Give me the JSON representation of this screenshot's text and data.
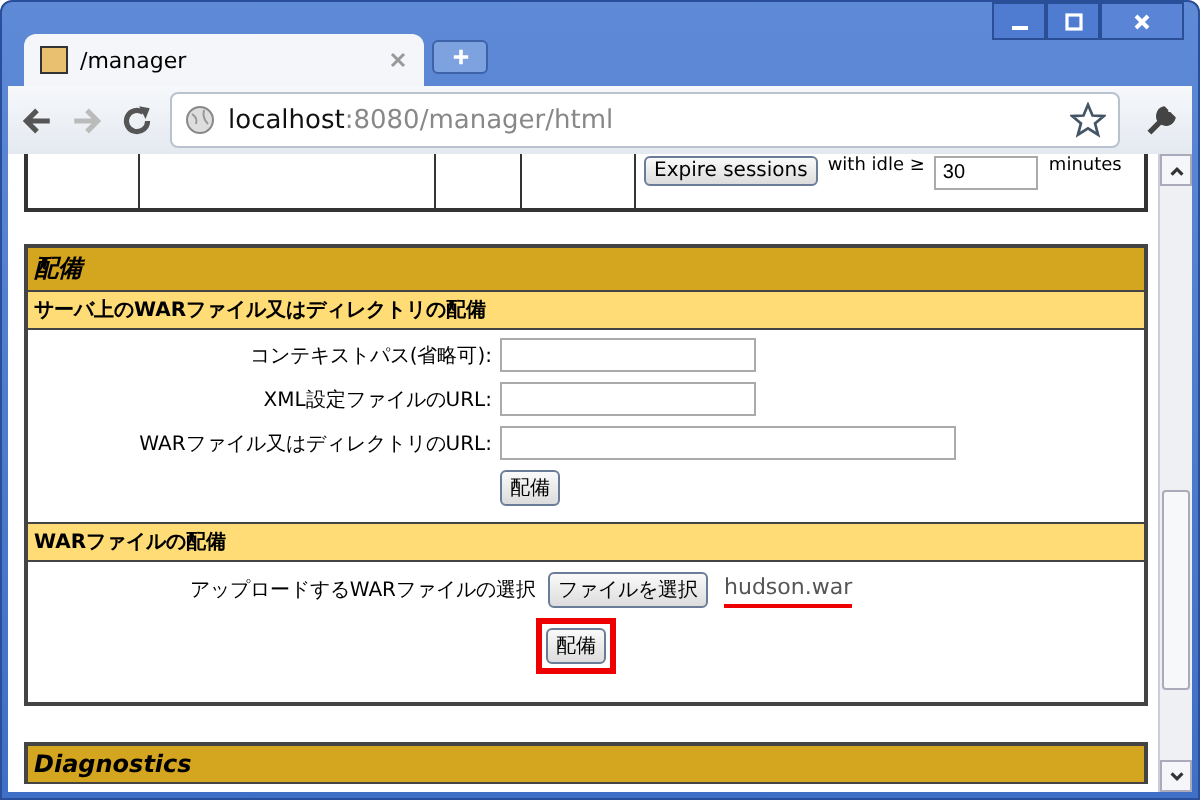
{
  "window": {
    "tab_title": "/manager",
    "address": {
      "host": "localhost",
      "rest": ":8080/manager/html"
    }
  },
  "sessions_row": {
    "expire_button": "Expire sessions",
    "idle_label": "with idle ≥",
    "idle_value": "30",
    "unit": "minutes"
  },
  "deploy": {
    "title": "配備",
    "server_section": {
      "title": "サーバ上のWARファイル又はディレクトリの配備",
      "fields": [
        {
          "label": "コンテキストパス(省略可):",
          "kind": "short"
        },
        {
          "label": "XML設定ファイルのURL:",
          "kind": "short"
        },
        {
          "label": "WARファイル又はディレクトリのURL:",
          "kind": "long"
        }
      ],
      "button": "配備"
    },
    "upload_section": {
      "title": "WARファイルの配備",
      "file_label": "アップロードするWARファイルの選択",
      "choose_button": "ファイルを選択",
      "file_name": "hudson.war",
      "file_underlined": true,
      "button": "配備",
      "button_highlighted": true
    }
  },
  "diagnostics": {
    "title": "Diagnostics"
  }
}
